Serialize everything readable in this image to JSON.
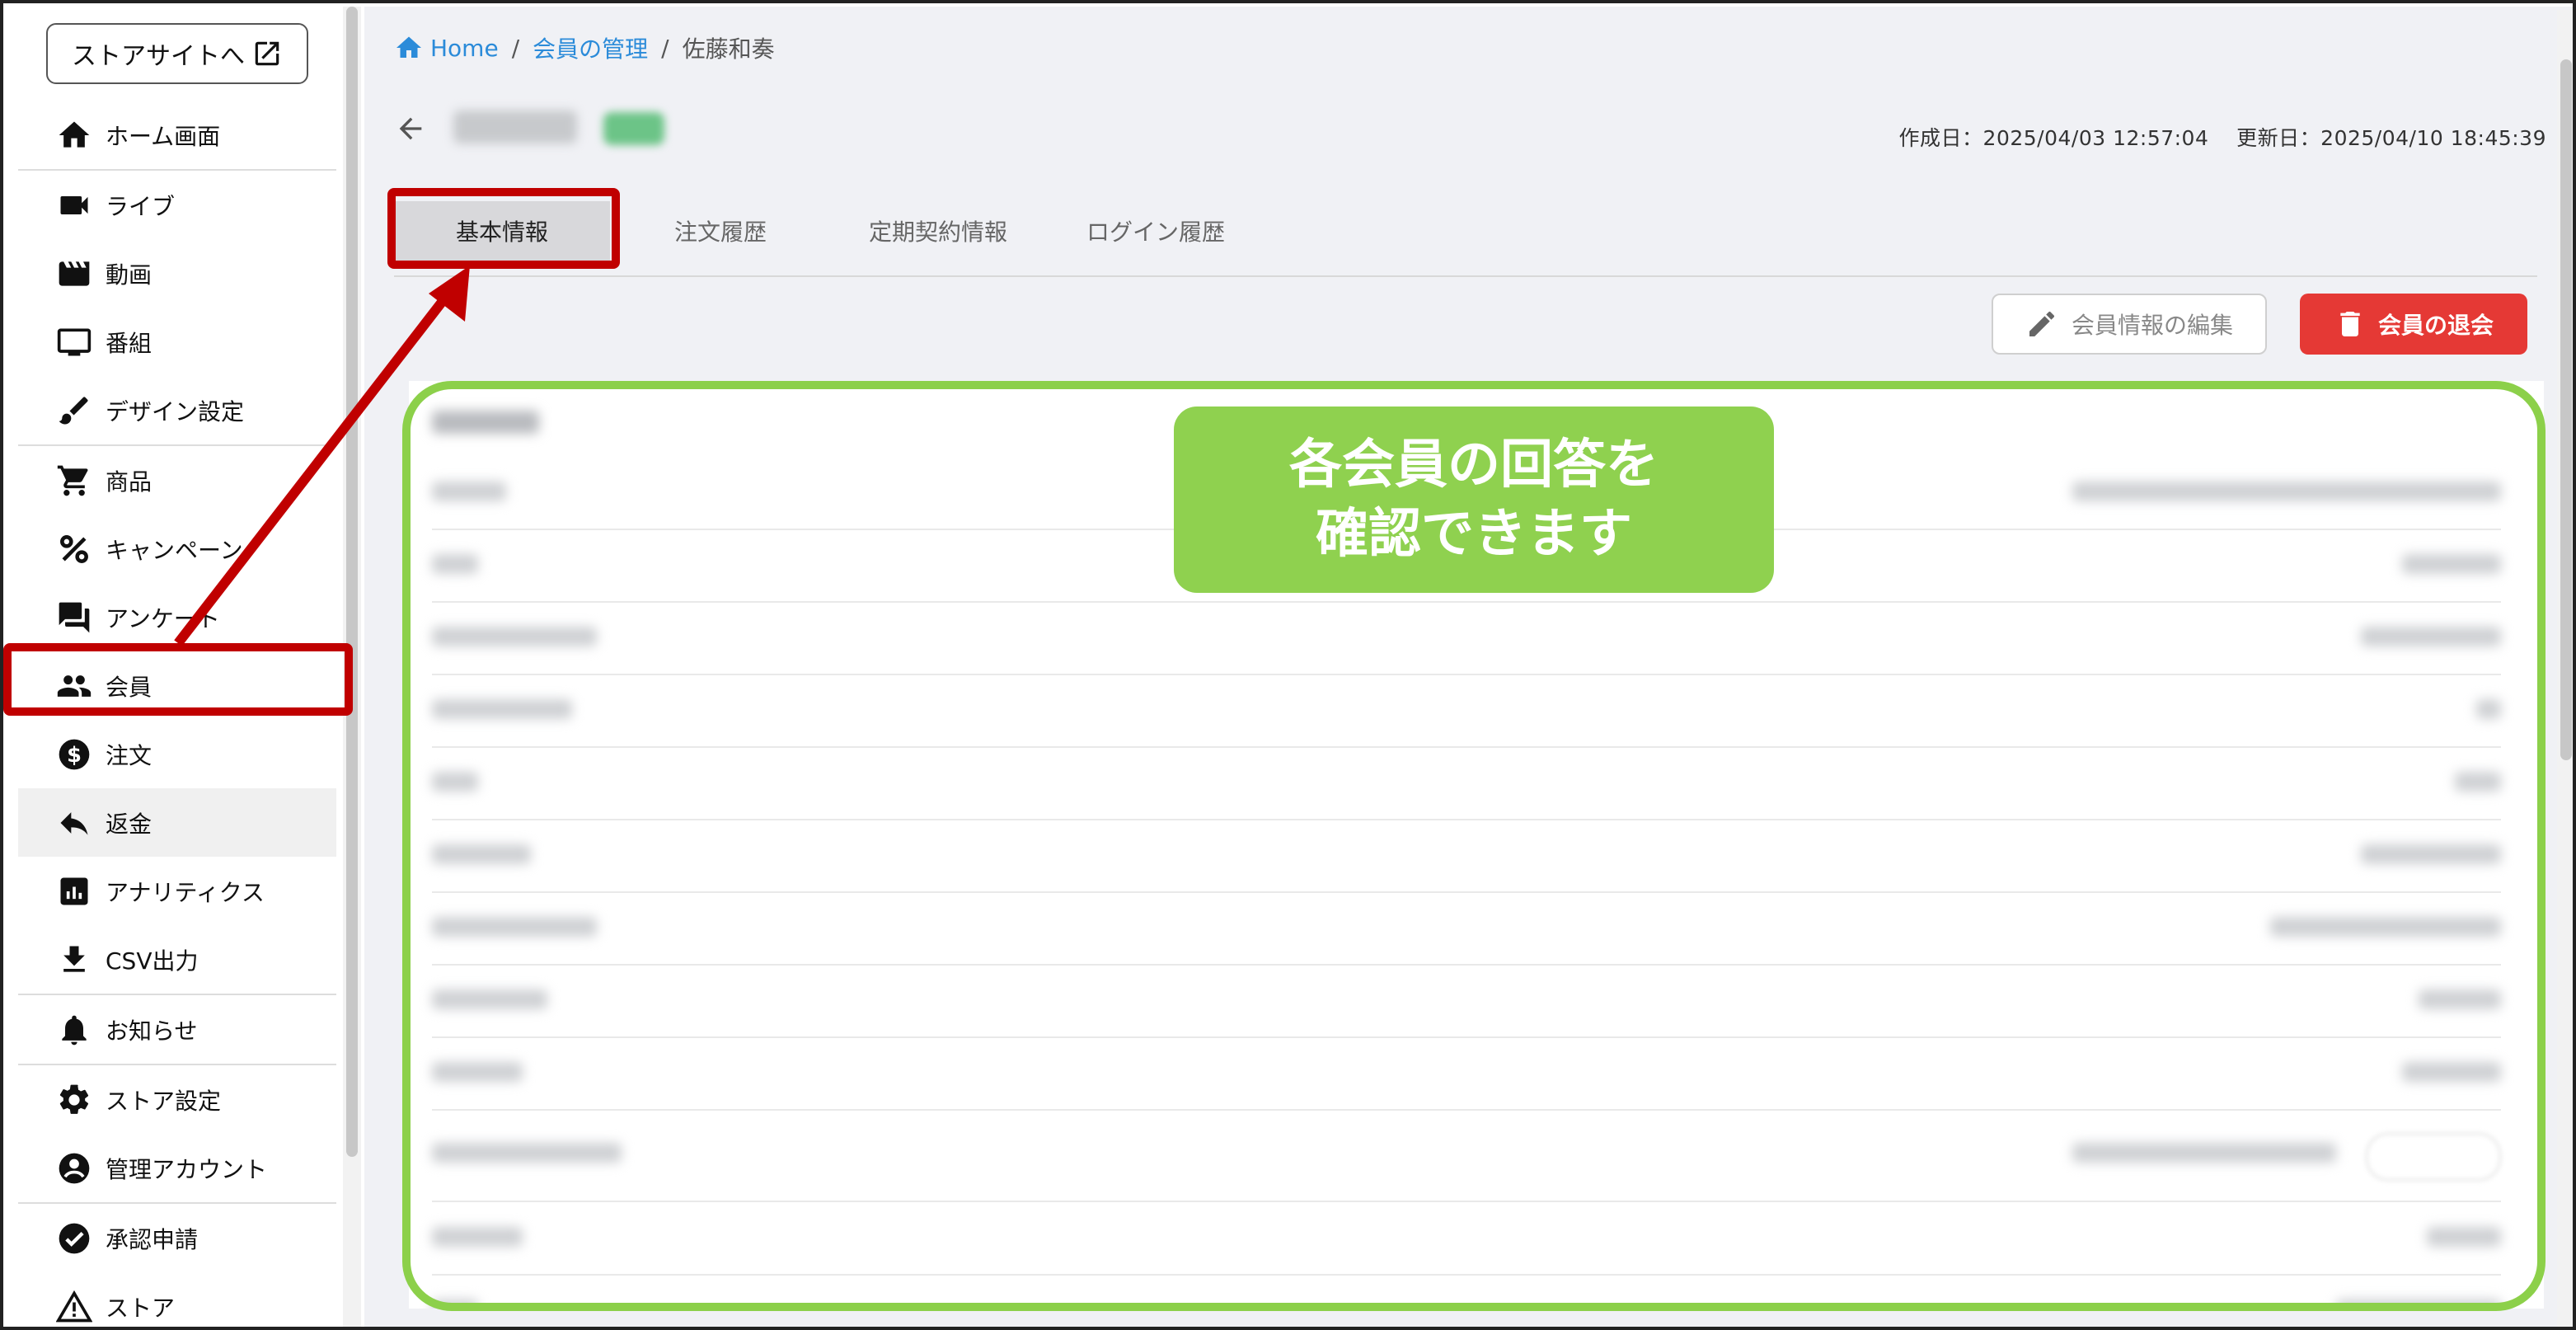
{
  "sidebar": {
    "store_link": "ストアサイトへ",
    "items": [
      {
        "label": "ホーム画面",
        "icon": "home-icon"
      },
      {
        "label": "ライブ",
        "icon": "videocam-icon"
      },
      {
        "label": "動画",
        "icon": "movie-icon"
      },
      {
        "label": "番組",
        "icon": "tv-icon"
      },
      {
        "label": "デザイン設定",
        "icon": "brush-icon"
      },
      {
        "label": "商品",
        "icon": "cart-icon"
      },
      {
        "label": "キャンペーン",
        "icon": "percent-icon"
      },
      {
        "label": "アンケート",
        "icon": "forum-icon"
      },
      {
        "label": "会員",
        "icon": "people-icon"
      },
      {
        "label": "注文",
        "icon": "dollar-icon"
      },
      {
        "label": "返金",
        "icon": "reply-icon"
      },
      {
        "label": "アナリティクス",
        "icon": "analytics-icon"
      },
      {
        "label": "CSV出力",
        "icon": "download-icon"
      },
      {
        "label": "お知らせ",
        "icon": "bell-icon"
      },
      {
        "label": "ストア設定",
        "icon": "gear-icon"
      },
      {
        "label": "管理アカウント",
        "icon": "account-icon"
      },
      {
        "label": "承認申請",
        "icon": "check-circle-icon"
      },
      {
        "label": "ストア",
        "icon": "warning-icon"
      }
    ]
  },
  "breadcrumb": {
    "home": "Home",
    "separator": "/",
    "parent": "会員の管理",
    "current": "佐藤和奏"
  },
  "dates": {
    "created": "作成日：2025/04/03 12:57:04",
    "updated": "更新日：2025/04/10 18:45:39"
  },
  "tabs": [
    "基本情報",
    "注文履歴",
    "定期契約情報",
    "ログイン履歴"
  ],
  "actions": {
    "edit": "会員情報の編集",
    "withdraw": "会員の退会"
  },
  "annotation": {
    "callout": "各会員の回答を\n確認できます"
  },
  "colors": {
    "accent_link": "#2b8bd9",
    "danger": "#e53935",
    "highlight_red": "#c00000",
    "highlight_green": "#8cd04a"
  }
}
